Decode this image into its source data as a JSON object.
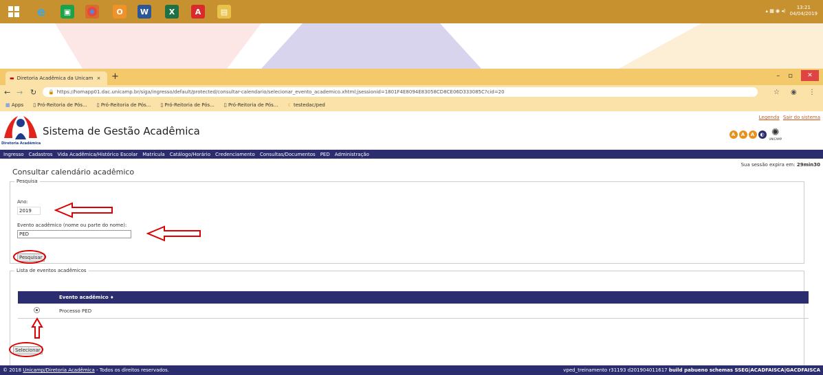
{
  "taskbar": {
    "apps": [
      "windows-start",
      "internet-explorer",
      "store",
      "chrome",
      "outlook",
      "word",
      "excel",
      "acrobat",
      "file-explorer"
    ],
    "clock_time": "13:21",
    "clock_date": "04/04/2019"
  },
  "browser": {
    "tab_title": "Diretoria Acadêmica da Unicamp",
    "url": "https://homapp01.dac.unicamp.br/siga/ingresso/default/protected/consultar-calendario/selecionar_evento_academico.xhtml;jsessionid=1801F4E8094E83058CD8CE06D333085C?cid=20",
    "bookmarks": [
      "Apps",
      "Pró-Reitoria de Pós...",
      "Pró-Reitoria de Pós...",
      "Pró-Reitoria de Pós...",
      "Pró-Reitoria de Pós...",
      "testedac/ped"
    ]
  },
  "header": {
    "logo_caption": "Diretoria Acadêmica",
    "system_title": "Sistema de Gestão Acadêmica",
    "link_legend": "Legenda",
    "link_logout": "Sair do sistema",
    "unicamp_caption": "UNICAMP"
  },
  "menu": [
    "Ingresso",
    "Cadastros",
    "Vida Acadêmica/Histórico Escolar",
    "Matrícula",
    "Catálogo/Horário",
    "Credenciamento",
    "Consultas/Documentos",
    "PED",
    "Administração"
  ],
  "session": {
    "label": "Sua sessão expira em:",
    "value": "29min30"
  },
  "page_title": "Consultar calendário acadêmico",
  "search": {
    "legend": "Pesquisa",
    "year_label": "Ano:",
    "year_value": "2019",
    "event_label": "Evento acadêmico (nome ou parte do nome):",
    "event_value": "PED",
    "search_button": "Pesquisar"
  },
  "events": {
    "legend": "Lista de eventos acadêmicos",
    "column_header": "Evento acadêmico",
    "sort_indicator": "♦",
    "rows": [
      {
        "name": "Processo PED",
        "selected": true
      }
    ],
    "select_button": "Selecionar"
  },
  "footer": {
    "left_prefix": "© 2018",
    "left_link": "Unicamp/Diretoria Acadêmica",
    "left_suffix": "- Todos os direitos reservados.",
    "right_text": "vped_treinamento r31193 d201904011617",
    "right_bold": "build pabueno schemas SSEG|ACADFAISCA|GACDFAISCA"
  },
  "colors": {
    "taskbar": "#c8912f",
    "menu_bar": "#2c2d6e",
    "annotation_red": "#dd0000",
    "unicamp_orange": "#e8901c"
  }
}
